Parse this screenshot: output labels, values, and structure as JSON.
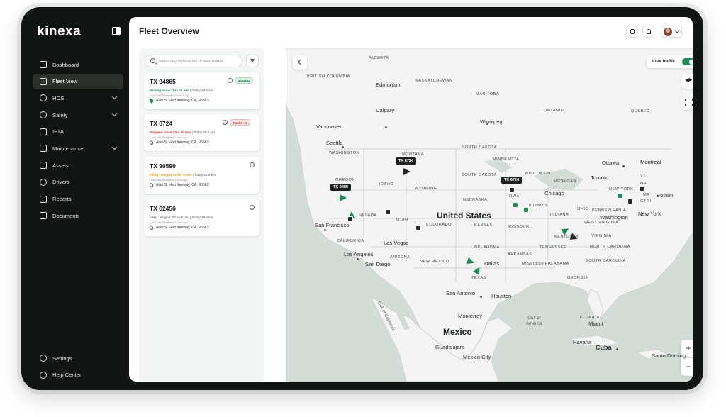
{
  "brand": "kinexa",
  "page_title": "Fleet Overview",
  "nav": {
    "items": [
      {
        "label": "Dashboard",
        "icon": "dashboard-icon"
      },
      {
        "label": "Fleet View",
        "icon": "map-icon",
        "active": true
      },
      {
        "label": "HOS",
        "icon": "clock-icon",
        "expandable": true
      },
      {
        "label": "Safety",
        "icon": "shield-icon",
        "expandable": true
      },
      {
        "label": "IFTA",
        "icon": "fuel-icon"
      },
      {
        "label": "Maintenance",
        "icon": "wrench-icon",
        "expandable": true
      },
      {
        "label": "Assets",
        "icon": "box-icon"
      },
      {
        "label": "Drivers",
        "icon": "driver-icon"
      },
      {
        "label": "Reports",
        "icon": "report-icon"
      },
      {
        "label": "Documents",
        "icon": "document-icon"
      }
    ],
    "bottom": [
      {
        "label": "Settings",
        "icon": "gear-icon"
      },
      {
        "label": "Help Center",
        "icon": "headset-icon"
      }
    ]
  },
  "search": {
    "placeholder": "Search by Vehicle No./Driver Name..."
  },
  "vehicles": [
    {
      "id": "TX 94865",
      "status": "Moving since 1hrs 20 min",
      "today": "Today:28.5 km",
      "status_color": "#1f8a52",
      "received": "Last Data Recieved 10 mins ago",
      "location": "Alan S. Hart freeway, CA, 95663",
      "badge": "60 MPH"
    },
    {
      "id": "TX 6724",
      "status": "Stopped since 1hrs 20 min",
      "today": "Today:28.5 km",
      "status_color": "#d2352b",
      "received": "Last Data Recieved 1 hour ago",
      "location": "Alan S. Hart freeway, CA, 95663",
      "badge": "Faults : 2"
    },
    {
      "id": "TX 90590",
      "status": "Idling - Engine on for 5 min",
      "today": "Today:28.5 km",
      "status_color": "#d9a316",
      "received": "Last Data Recieved 1 hour ago",
      "location": "Alan S. Hart freeway, CA, 95663",
      "badge": ""
    },
    {
      "id": "TX 62456",
      "status": "Idling - Engine Off for 5 min",
      "today": "Today:28.5 km",
      "status_color": "#4b514e",
      "received": "Last Data Recieved 1 hour ago",
      "location": "Alan S. Hart freeway, CA, 95663",
      "badge": ""
    }
  ],
  "map": {
    "live_traffic_label": "Live traffic",
    "live_traffic_on": true,
    "zoom_in": "+",
    "zoom_out": "−",
    "markers": [
      "TX 9485",
      "TX 6724",
      "TX 6724"
    ],
    "labels": {
      "countries": [
        "United States",
        "Mexico"
      ],
      "provinces": [
        "ALBERTA",
        "BRITISH COLUMBIA",
        "SASKATCHEWAN",
        "MANITOBA",
        "ONTARIO",
        "QUEBEC"
      ],
      "states": [
        "WASHINGTON",
        "MONTANA",
        "NORTH DAKOTA",
        "MINNESOTA",
        "OREGON",
        "IDAHO",
        "WYOMING",
        "SOUTH DAKOTA",
        "WISCONSIN",
        "MICHIGAN",
        "NEBRASKA",
        "IOWA",
        "NEVADA",
        "UTAH",
        "COLORADO",
        "KANSAS",
        "ILLINOIS",
        "INDIANA",
        "OHIO",
        "MISSOURI",
        "KENTUCKY",
        "CALIFORNIA",
        "ARIZONA",
        "NEW MEXICO",
        "OKLAHOMA",
        "TENNESSEE",
        "ARKANSAS",
        "TEXAS",
        "MISSISSIPPI",
        "ALABAMA",
        "GEORGIA",
        "SOUTH CAROLINA",
        "NORTH CAROLINA",
        "WEST VIRGINIA",
        "VIRGINIA",
        "PENNSYLVANIA",
        "NEW YORK",
        "VT",
        "NH",
        "MA",
        "CT",
        "RI",
        "FLORIDA"
      ],
      "cities": [
        "Edmonton",
        "Calgary",
        "Winnipeg",
        "Vancouver",
        "Seattle",
        "Ottawa",
        "Montreal",
        "Toronto",
        "Chicago",
        "Boston",
        "New York",
        "Washington",
        "San Francisco",
        "Las Vegas",
        "Los Angeles",
        "San Diego",
        "Dallas",
        "San Antonio",
        "Houston",
        "Monterrey",
        "Guadalajara",
        "Mexico City",
        "Miami",
        "Havana",
        "Santo Domingo"
      ],
      "cuba": "Cuba",
      "gulf_mexico": "Gulf of\nAmerica",
      "gulf_california": "Gulf of California"
    }
  }
}
